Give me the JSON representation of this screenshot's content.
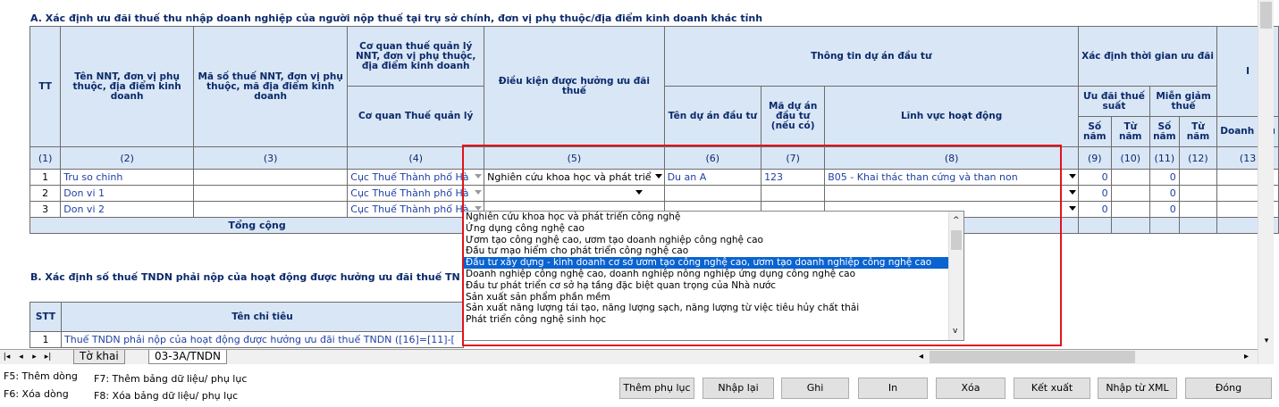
{
  "section_a": {
    "title": "A. Xác định ưu đãi thuế thu nhập doanh nghiệp của người nộp thuế tại trụ sở chính, đơn vị phụ thuộc/địa điểm kinh doanh khác tỉnh",
    "headers": {
      "tt": "TT",
      "ten_nnt": "Tên NNT, đơn vị phụ thuộc, địa điểm kinh doanh",
      "mst": "Mã số thuế NNT, đơn vị phụ thuộc, mã địa điểm kinh doanh",
      "cq_group": "Cơ quan thuế quản lý NNT, đơn vị phụ thuộc, địa điểm kinh doanh",
      "cq": "Cơ quan Thuế quản lý",
      "dieu_kien": "Điều kiện được hưởng ưu đãi thuế",
      "thong_tin": "Thông tin dự án đầu tư",
      "ten_da": "Tên dự án đầu tư",
      "ma_da": "Mã dự án đầu tư (nếu có)",
      "linh_vuc": "Lĩnh vực hoạt động",
      "xac_dinh": "Xác định thời gian ưu đãi",
      "uu_dai": "Ưu đãi thuế suất",
      "mien_giam": "Miễn giảm thuế",
      "so_nam": "Số năm",
      "tu_nam": "Từ năm",
      "doanh_thu": "Doanh thu",
      "cut_right": "I"
    },
    "col_nums": [
      "(1)",
      "(2)",
      "(3)",
      "(4)",
      "(5)",
      "(6)",
      "(7)",
      "(8)",
      "(9)",
      "(10)",
      "(11)",
      "(12)",
      "(13"
    ],
    "rows": [
      {
        "tt": "1",
        "ten": "Tru so chinh",
        "mst": "",
        "cq": "Cục Thuế Thành phố Hà",
        "dk": "Nghiên cứu khoa học và phát triể",
        "ten_da": "Du an A",
        "ma_da": "123",
        "lv": "B05 - Khai thác than cứng và than non",
        "so_nam": "0",
        "so_nam2": "0"
      },
      {
        "tt": "2",
        "ten": "Don vi 1",
        "mst": "",
        "cq": "Cục Thuế Thành phố Hà",
        "dk": "",
        "ten_da": "",
        "ma_da": "",
        "lv": "",
        "so_nam": "0",
        "so_nam2": "0"
      },
      {
        "tt": "3",
        "ten": "Don vi 2",
        "mst": "",
        "cq": "Cục Thuế Thành phố Hà",
        "dk": "",
        "ten_da": "",
        "ma_da": "",
        "lv": "",
        "so_nam": "0",
        "so_nam2": "0"
      }
    ],
    "total_label": "Tổng cộng"
  },
  "section_b": {
    "title": "B. Xác định số thuế TNDN phải nộp của hoạt động được hưởng ưu đãi thuế TN",
    "stt": "STT",
    "ten_chi_tieu": "Tên chỉ tiêu",
    "row1_no": "1",
    "row1_text": "Thuế TNDN phải nộp của hoạt động được hưởng ưu đãi thuế TNDN ([16]=[11]-["
  },
  "dropdown": {
    "items": [
      "Nghiên cứu khoa học và phát triển công nghệ",
      "Ứng dụng công nghệ cao",
      "Ươm tạo công nghệ cao, ươm tạo doanh nghiệp công nghệ cao",
      "Đầu tư mạo hiểm cho phát triển công nghệ cao",
      "Đầu tư xây dựng - kinh doanh cơ sở ươm tạo công nghệ cao, ươm tạo doanh nghiệp công nghệ cao",
      "Doanh nghiệp công nghệ cao, doanh nghiệp nông nghiệp ứng dụng công nghệ cao",
      "Đầu tư phát triển cơ sở hạ tầng đặc biệt quan trọng của Nhà nước",
      "Sản xuất sản phẩm phần mềm",
      "Sản xuất năng lượng tái tạo, năng lượng sạch, năng lượng từ việc tiêu hủy chất thải",
      "Phát triển công nghệ sinh học"
    ],
    "highlight_index": 4
  },
  "tabs": {
    "tab1": "Tờ khai",
    "tab2": "03-3A/TNDN"
  },
  "hints": {
    "f5": "F5: Thêm dòng",
    "f6": "F6: Xóa dòng",
    "f7": "F7: Thêm bảng dữ liệu/ phụ lục",
    "f8": "F8: Xóa bảng dữ liệu/ phụ lục"
  },
  "buttons": {
    "them_phu_luc": "Thêm phụ lục",
    "nhap_lai": "Nhập lại",
    "ghi": "Ghi",
    "in": "In",
    "xoa": "Xóa",
    "ket_xuat": "Kết xuất",
    "nhap_xml": "Nhập từ XML",
    "dong": "Đóng"
  },
  "colors": {
    "header_bg": "#d9e6f5",
    "highlight": "#0a63d0",
    "red_box": "#e0141b",
    "link_text": "#1f3fa5"
  }
}
